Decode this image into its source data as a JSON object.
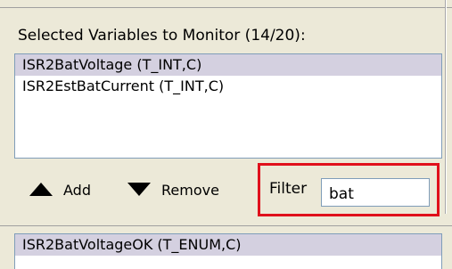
{
  "section": {
    "title": "Selected Variables to Monitor (14/20):"
  },
  "selected_list": {
    "items": [
      {
        "label": "ISR2BatVoltage (T_INT,C)",
        "selected": true
      },
      {
        "label": "ISR2EstBatCurrent (T_INT,C)",
        "selected": false
      }
    ]
  },
  "buttons": {
    "add_label": "Add",
    "remove_label": "Remove"
  },
  "filter": {
    "label": "Filter",
    "value": "bat"
  },
  "available_list": {
    "items": [
      {
        "label": "ISR2BatVoltageOK (T_ENUM,C)",
        "selected": true
      }
    ]
  },
  "colors": {
    "highlight_border": "#e0101c",
    "selection_background": "#d4d0e0",
    "panel_background": "#ece9d8"
  },
  "icons": {
    "add": "triangle-up-icon",
    "remove": "triangle-down-icon"
  }
}
